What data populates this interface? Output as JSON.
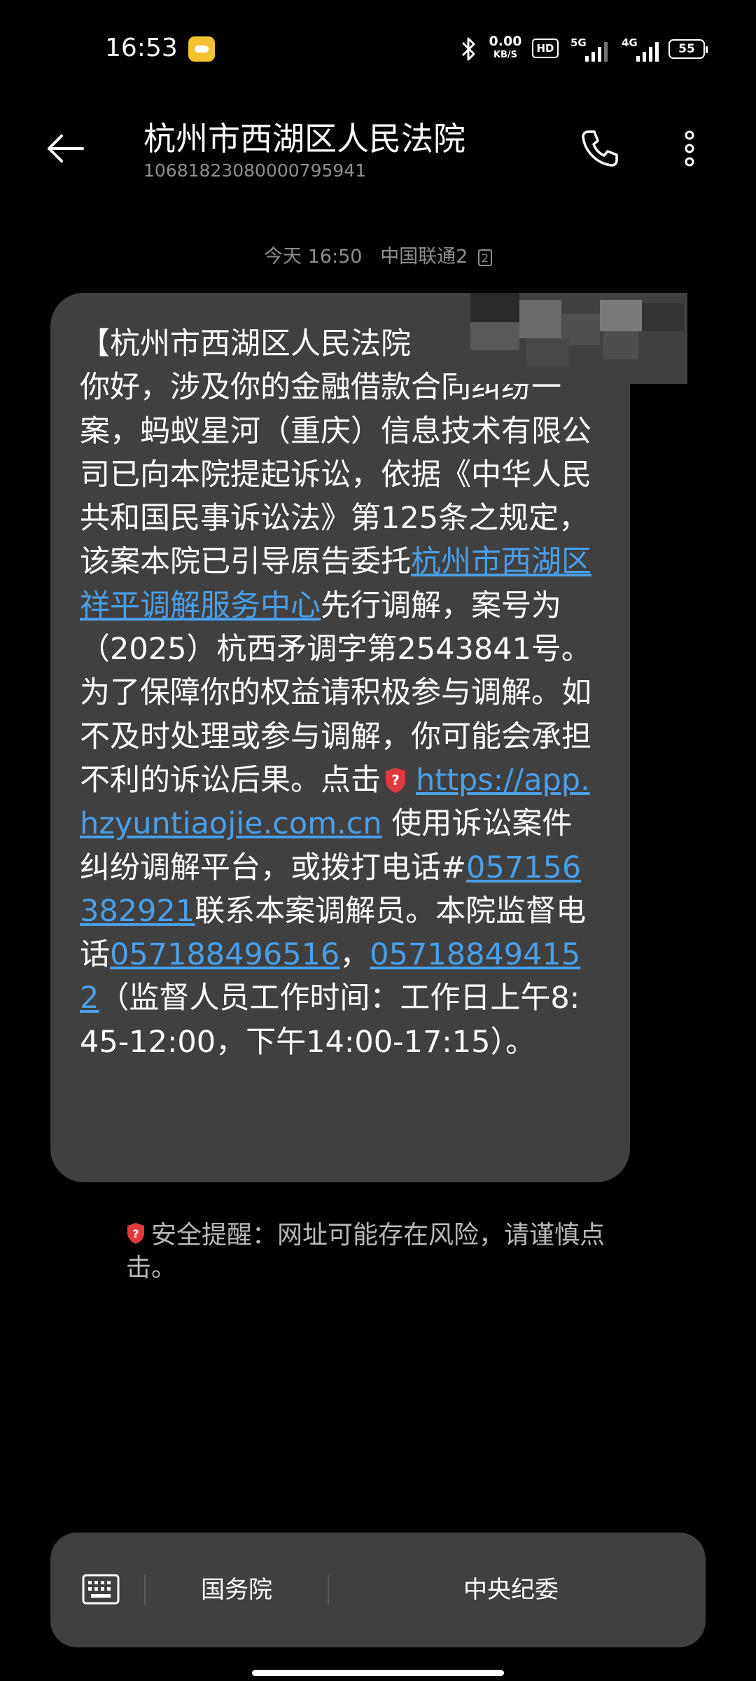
{
  "status_bar": {
    "time": "16:53",
    "net_speed": "0.00",
    "net_speed_unit": "KB/S",
    "hd_label": "HD",
    "signal_1_label": "5G",
    "signal_2_label": "4G",
    "battery": "55"
  },
  "header": {
    "contact_name": "杭州市西湖区人民法院",
    "contact_number": "10681823080000795941"
  },
  "message": {
    "time": "今天 16:50",
    "carrier": "中国联通2",
    "sim_slot": "2",
    "text": {
      "p1": "【杭州市西湖区人民法院",
      "p2": "你好，涉及你的金融借款合同纠纷一案，蚂蚁星河（重庆）信息技术有限公司已向本院提起诉讼，依据《中华人民共和国民事诉讼法》第125条之规定，该案本院已引导原告委托",
      "link_mediation_center": "杭州市西湖区祥平调解服务中心",
      "p3": "先行调解，案号为（2025）杭西矛调字第2543841号。为了保障你的权益请积极参与调解。如不及时处理或参与调解，你可能会承担不利的诉讼后果。点击",
      "link_url": "https://app.hzyuntiaojie.com.cn",
      "p4": " 使用诉讼案件纠纷调解平台，或拨打电话#",
      "phone_1": "057156382921",
      "p5": "联系本案调解员。本院监督电话",
      "phone_2": "057188496516",
      "p6": "，",
      "phone_3": "057188494152",
      "p7": "（监督人员工作时间：工作日上午8:45-12:00，下午14:00-17:15）。"
    }
  },
  "safety_tip": "安全提醒：网址可能存在风险，请谨慎点击。",
  "bottom_menu": {
    "item_1": "国务院",
    "item_2": "中央纪委"
  },
  "colors": {
    "background": "#000000",
    "bubble": "#404040",
    "link": "#4a9fe8",
    "warning_red": "#e0393e",
    "secondary_text": "#8e8e8e"
  }
}
